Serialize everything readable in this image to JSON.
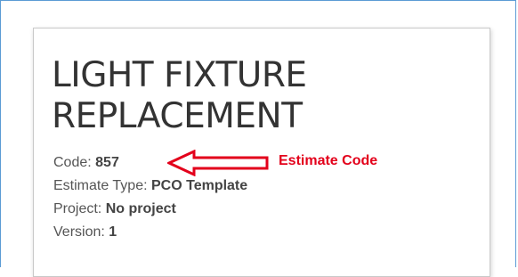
{
  "card": {
    "title_line1": "LIGHT FIXTURE",
    "title_line2": "REPLACEMENT",
    "fields": [
      {
        "label": "Code:",
        "value": "857"
      },
      {
        "label": "Estimate Type:",
        "value": "PCO Template"
      },
      {
        "label": "Project:",
        "value": "No project"
      },
      {
        "label": "Version:",
        "value": "1"
      }
    ]
  },
  "annotation": {
    "label": "Estimate Code",
    "color": "#e3001b",
    "icon": "left-arrow-icon"
  }
}
